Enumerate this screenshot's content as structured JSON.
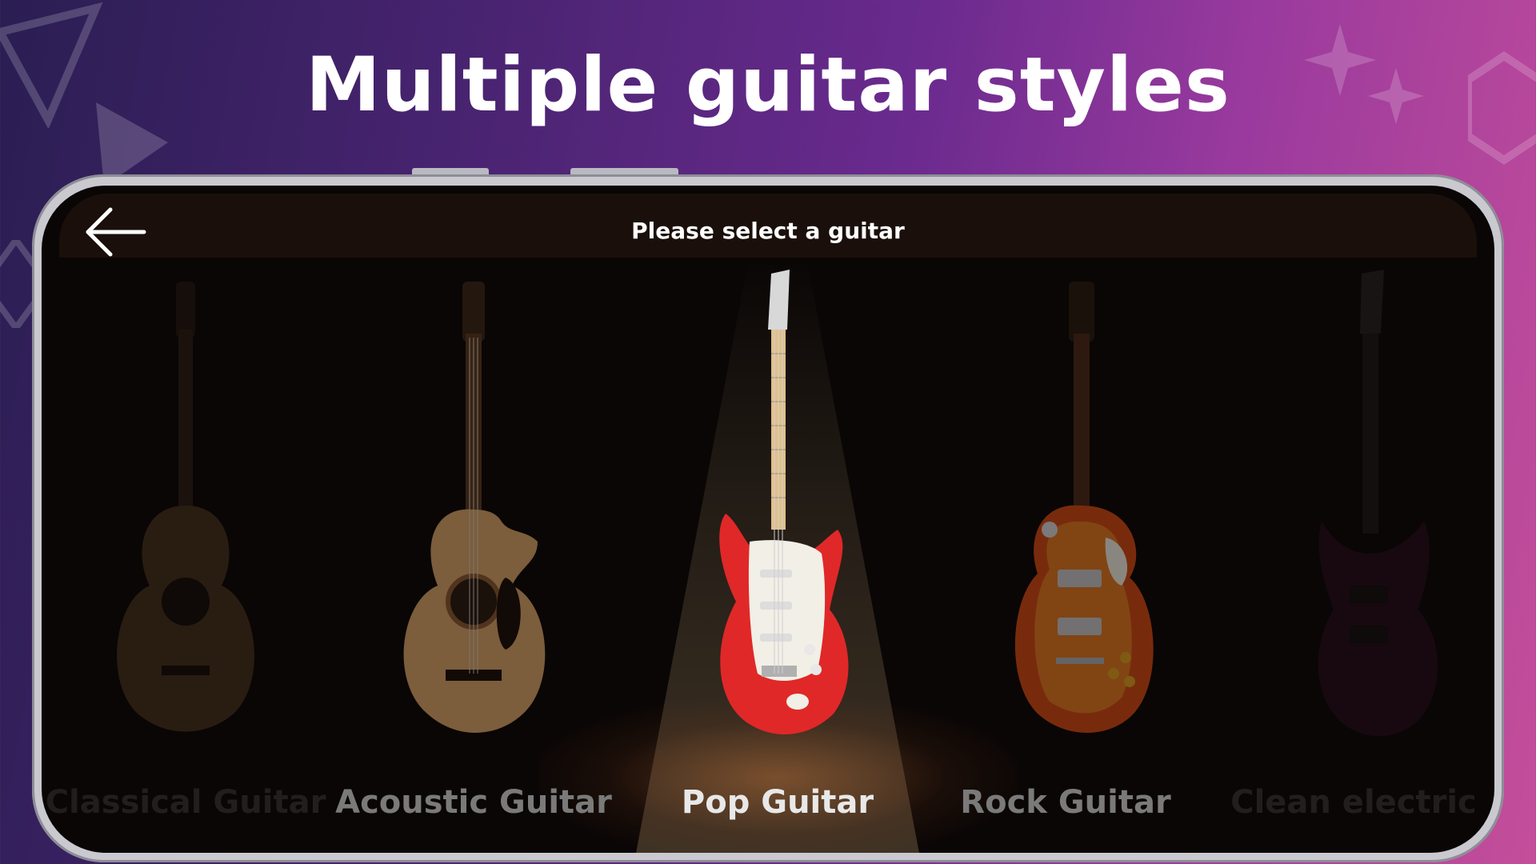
{
  "headline": "Multiple guitar styles",
  "header": {
    "title": "Please select a guitar",
    "back_icon": "arrow-left-icon"
  },
  "guitars": [
    {
      "label": "Classical Guitar",
      "type": "acoustic",
      "body_color": "#b8864a",
      "selected": false
    },
    {
      "label": "Acoustic Guitar",
      "type": "acoustic-cutaway",
      "body_color": "#d9a46a",
      "selected": false
    },
    {
      "label": "Pop Guitar",
      "type": "stratocaster",
      "body_color": "#e02828",
      "selected": true
    },
    {
      "label": "Rock Guitar",
      "type": "les-paul",
      "body_color": "#d24a12",
      "selected": false
    },
    {
      "label": "Clean electric",
      "type": "electric",
      "body_color": "#5a1a4a",
      "selected": false
    }
  ],
  "colors": {
    "accent": "#ffffff",
    "label_inactive": "#8a8a8a",
    "label_active": "#e8e8e8"
  }
}
